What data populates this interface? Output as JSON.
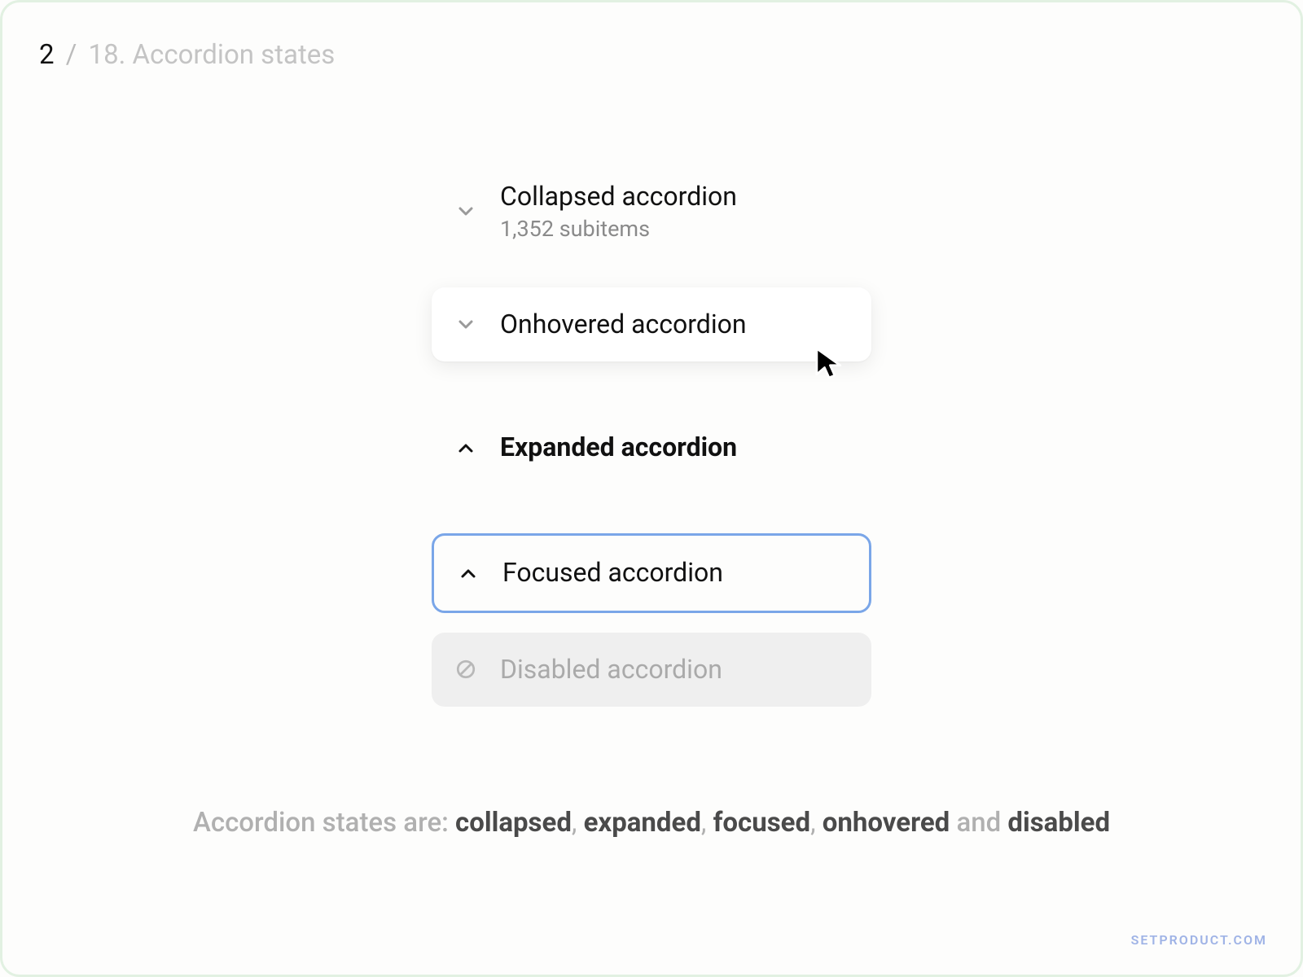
{
  "header": {
    "page_current": "2",
    "page_total": "18.",
    "title": "Accordion states"
  },
  "accordions": {
    "collapsed": {
      "label": "Collapsed accordion",
      "sub": "1,352 subitems"
    },
    "onhovered": {
      "label": "Onhovered accordion"
    },
    "expanded": {
      "label": "Expanded accordion"
    },
    "focused": {
      "label": "Focused accordion"
    },
    "disabled": {
      "label": "Disabled accordion"
    }
  },
  "caption": {
    "prefix": "Accordion states are: ",
    "kw1": "collapsed",
    "kw2": "expanded",
    "kw3": "focused",
    "kw4": "onhovered",
    "and": " and ",
    "kw5": "disabled"
  },
  "watermark": "SETPRODUCT.COM"
}
